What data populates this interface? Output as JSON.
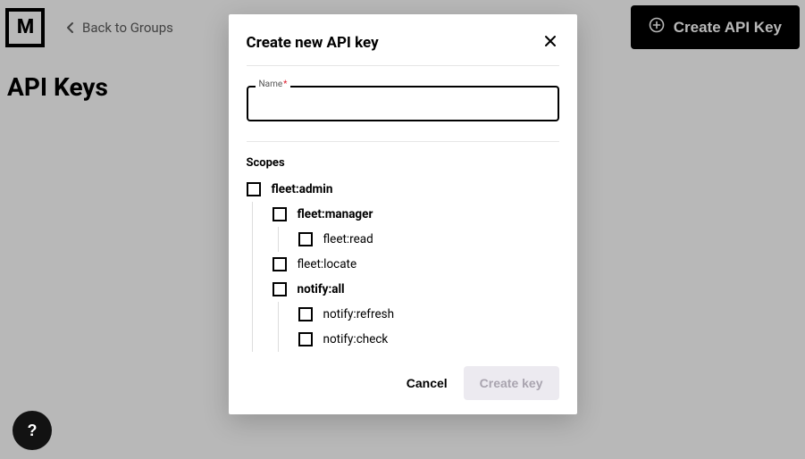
{
  "logo_letter": "M",
  "back_link": "Back to Groups",
  "create_button": "Create API Key",
  "page_title": "API Keys",
  "help_glyph": "?",
  "modal": {
    "title": "Create new API key",
    "name_label": "Name",
    "required_mark": "*",
    "scopes_heading": "Scopes",
    "scopes": [
      {
        "label": "fleet:admin",
        "bold": true,
        "depth": 0
      },
      {
        "label": "fleet:manager",
        "bold": true,
        "depth": 1
      },
      {
        "label": "fleet:read",
        "bold": false,
        "depth": 2
      },
      {
        "label": "fleet:locate",
        "bold": false,
        "depth": 1
      },
      {
        "label": "notify:all",
        "bold": true,
        "depth": 1
      },
      {
        "label": "notify:refresh",
        "bold": false,
        "depth": 2
      },
      {
        "label": "notify:check",
        "bold": false,
        "depth": 2
      }
    ],
    "cancel": "Cancel",
    "submit": "Create key"
  }
}
